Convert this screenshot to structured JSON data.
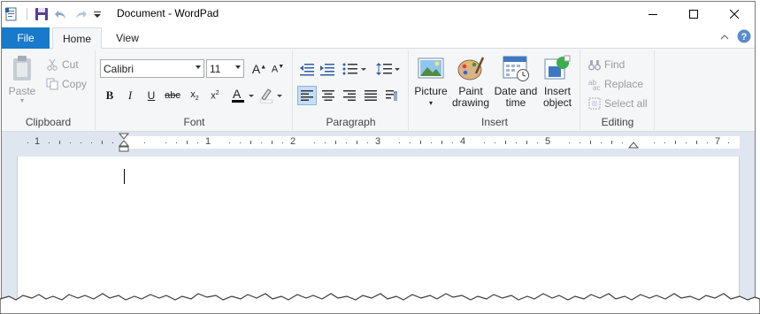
{
  "window": {
    "title": "Document - WordPad"
  },
  "tabs": {
    "file": "File",
    "home": "Home",
    "view": "View"
  },
  "clipboard": {
    "paste": "Paste",
    "cut": "Cut",
    "copy": "Copy",
    "label": "Clipboard"
  },
  "font": {
    "family": "Calibri",
    "size": "11",
    "label": "Font"
  },
  "paragraph": {
    "label": "Paragraph"
  },
  "insert": {
    "picture": "Picture",
    "paint_line1": "Paint",
    "paint_line2": "drawing",
    "datetime_line1": "Date and",
    "datetime_line2": "time",
    "object_line1": "Insert",
    "object_line2": "object",
    "label": "Insert"
  },
  "editing": {
    "find": "Find",
    "replace": "Replace",
    "select_all": "Select all",
    "label": "Editing"
  },
  "ruler": {
    "numbers": [
      "1",
      "1",
      "2",
      "3",
      "4",
      "5",
      "7"
    ]
  },
  "colors": {
    "file_tab": "#1979ca",
    "ribbon_bg": "#f5f6f7",
    "ruler_bg": "#dfe6f0",
    "help_icon": "#5a8ccb"
  }
}
